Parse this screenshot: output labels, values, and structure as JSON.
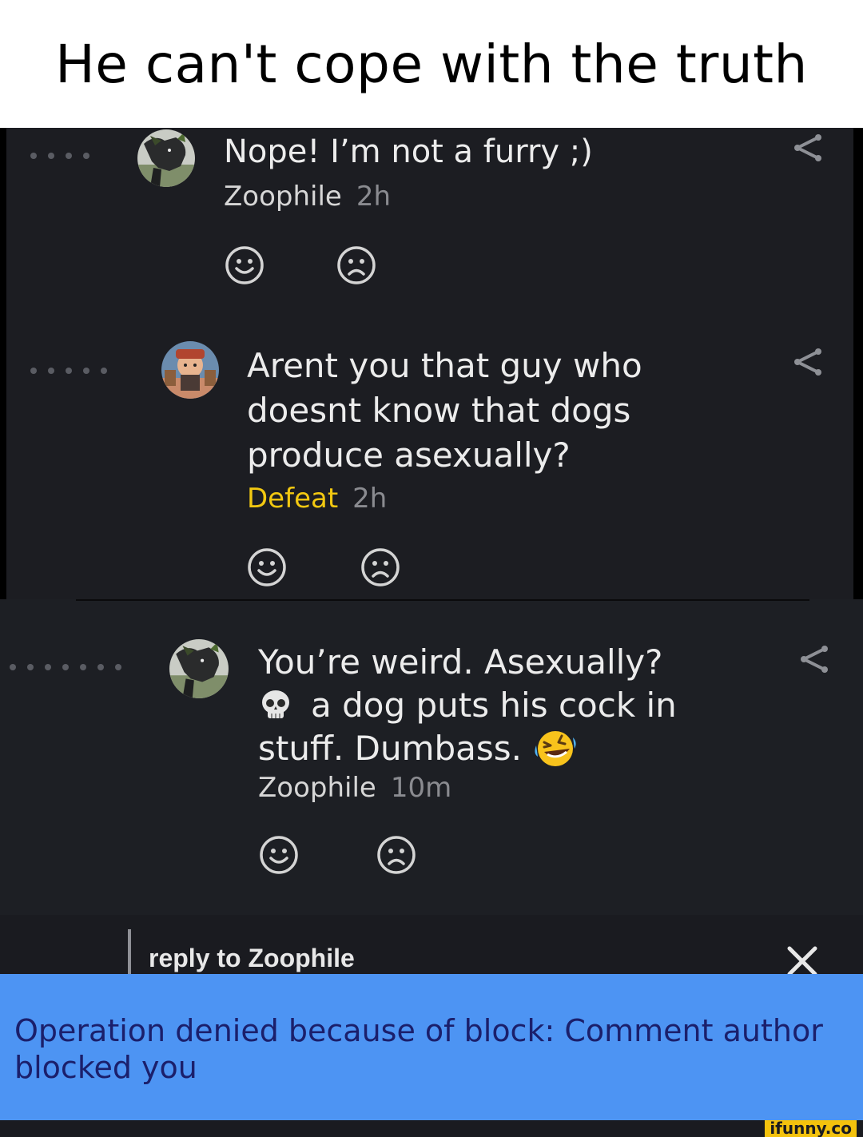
{
  "caption": "He can't cope with the truth",
  "comments": [
    {
      "text_lines": [
        "Nope! I’m not a furry ;)"
      ],
      "author": "Zoophile",
      "time": "2h",
      "author_color": "#d6d6d6",
      "avatar": "dog-avatar"
    },
    {
      "text_lines": [
        "Arent you that guy who",
        "doesnt know that dogs",
        "produce asexually?"
      ],
      "author": "Defeat",
      "time": "2h",
      "author_color": "#f2c811",
      "avatar": "cartoon-avatar"
    },
    {
      "text_lines": [
        "You’re weird. Asexually?",
        "a dog puts his cock in",
        "stuff. Dumbass."
      ],
      "emoji": [
        "skull",
        "rolling-on-floor-laughing"
      ],
      "author": "Zoophile",
      "time": "10m",
      "author_color": "#d6d6d6",
      "avatar": "dog-avatar"
    }
  ],
  "reply_bar": {
    "label": "reply to Zoophile",
    "close_icon": "close-icon"
  },
  "toast": {
    "message": "Operation denied because of block: Comment author blocked you"
  },
  "watermark": "ifunny.co",
  "colors": {
    "background": "#1c1d22",
    "toast": "#4d94f3",
    "toast_text": "#1b1f6b",
    "gold": "#f2c811"
  }
}
